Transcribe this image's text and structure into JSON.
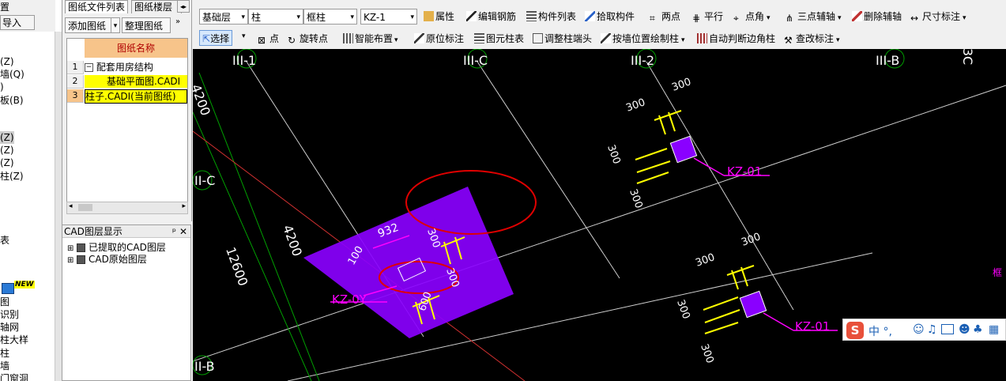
{
  "left_strip": {
    "button_label": "导入",
    "top_text": "置",
    "items": [
      "(Z)",
      "墙(Q)",
      ")",
      "板(B)",
      "(Z)",
      "(Z)",
      "(Z)",
      "柱(Z)",
      "表",
      "图",
      "识别",
      "轴网",
      "柱大样",
      "柱",
      "墙",
      "门窗洞"
    ],
    "new_badge": "NEW"
  },
  "drawing_panel": {
    "tabs": [
      "图纸文件列表",
      "图纸楼层"
    ],
    "buttons": [
      "添加图纸",
      "整理图纸"
    ],
    "column_header": "图纸名称",
    "rows": [
      {
        "num": "1",
        "name": "配套用房结构"
      },
      {
        "num": "2",
        "name": "基础平面图.CADI"
      },
      {
        "num": "3",
        "name": "柱子.CADI(当前图纸)"
      }
    ]
  },
  "layer_panel": {
    "title": "CAD图层显示",
    "pin": "ᵖ",
    "close": "✕",
    "items": [
      "已提取的CAD图层",
      "CAD原始图层"
    ]
  },
  "toolbar1": {
    "floor": "基础层",
    "type": "柱",
    "subtype": "框柱",
    "component": "KZ-1",
    "tools": [
      "属性",
      "编辑钢筋",
      "构件列表",
      "拾取构件",
      "两点",
      "平行",
      "点角",
      "三点辅轴",
      "删除辅轴",
      "尺寸标注"
    ]
  },
  "toolbar2": {
    "tools": [
      "选择",
      "点",
      "旋转点",
      "智能布置",
      "原位标注",
      "图元柱表",
      "调整柱端头",
      "按墙位置绘制柱",
      "自动判断边角柱",
      "查改标注"
    ]
  },
  "canvas": {
    "axis_labels": [
      "III-1",
      "III-C",
      "III-2",
      "III-B",
      "II-C",
      "II-B",
      "3C"
    ],
    "dimensions": [
      "4200",
      "4200",
      "12600",
      "932",
      "100",
      "300",
      "300",
      "600",
      "300",
      "300",
      "300",
      "300",
      "300",
      "300",
      "300",
      "300"
    ],
    "columns": [
      "KZ-01",
      "KZ-01",
      "KZ-0Y"
    ],
    "side_text": "框"
  },
  "ime": {
    "logo": "S",
    "text": "中 °,"
  },
  "colors": {
    "canvas_bg": "#000000",
    "column_fill": "#8a00ff",
    "dim_yellow": "#ffff00",
    "label_magenta": "#ff00ff",
    "circle_red": "#e00000",
    "axis_green": "#00a000"
  }
}
